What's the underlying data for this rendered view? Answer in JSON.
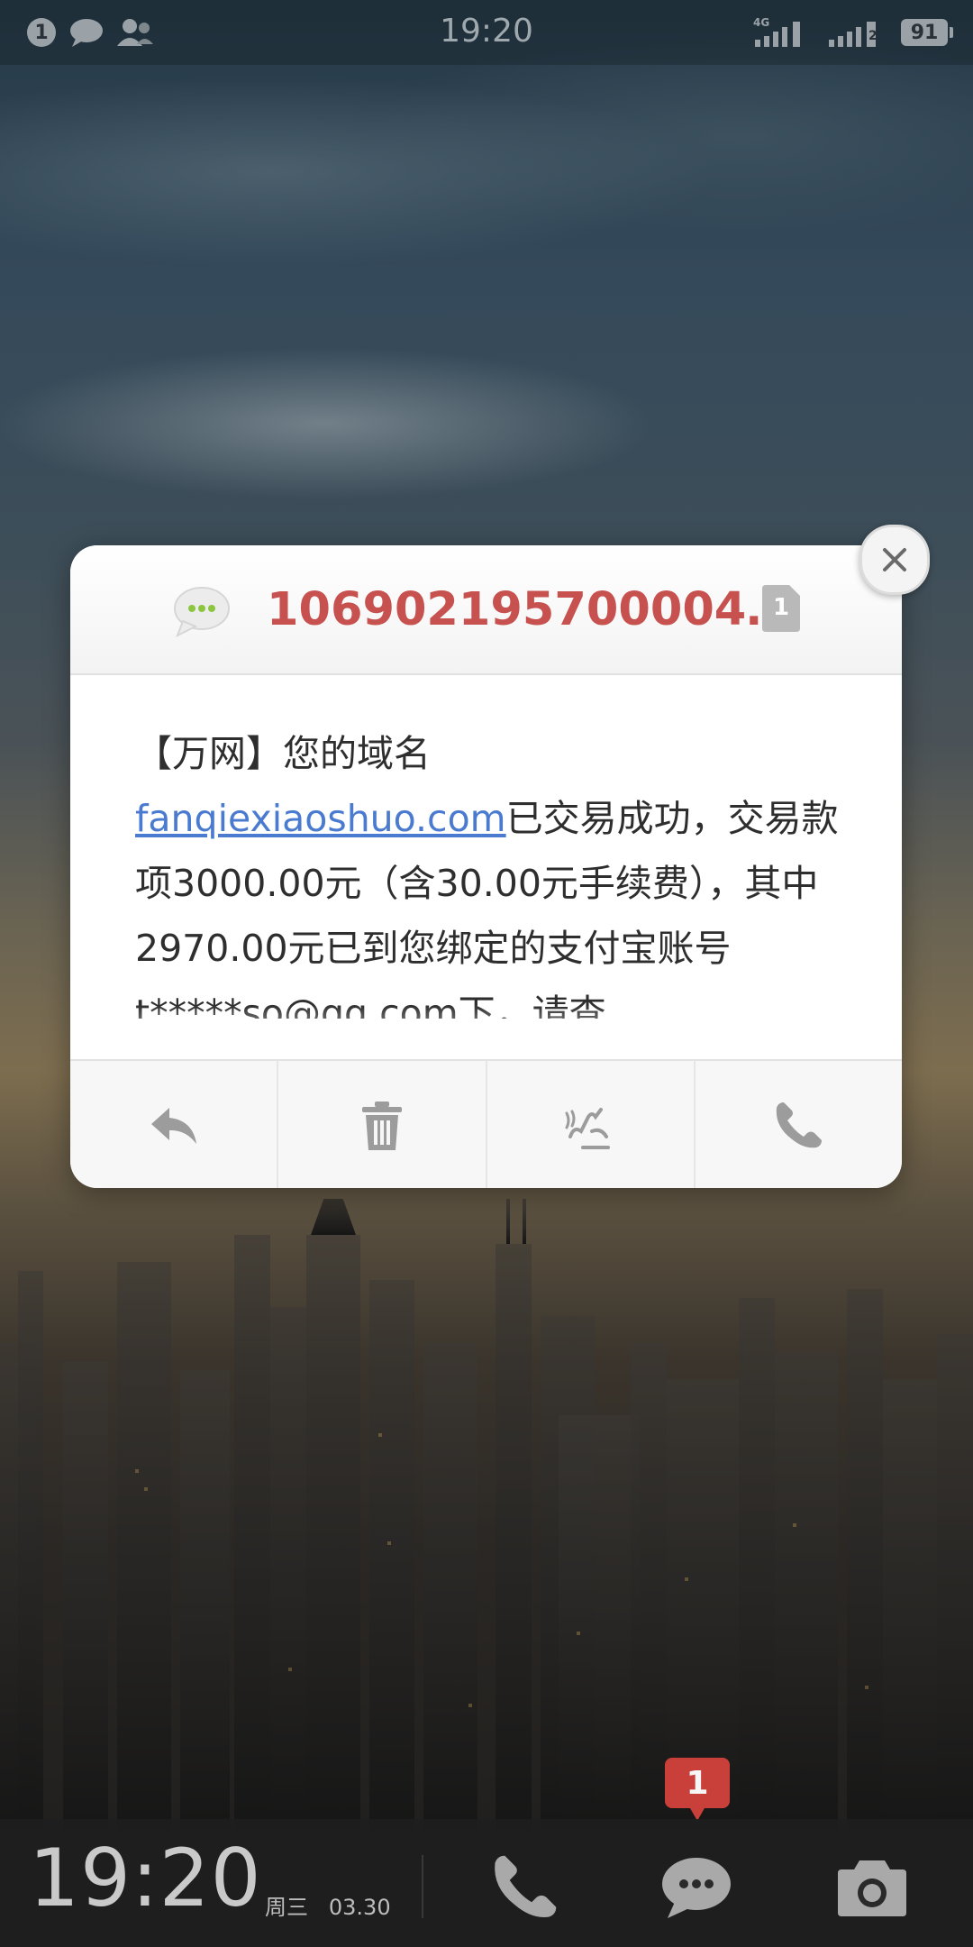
{
  "status_bar": {
    "notification_count": "1",
    "time": "19:20",
    "network_label": "4G",
    "sim2_label": "2",
    "battery": "91"
  },
  "dialog": {
    "sender": "1069021957000040...",
    "body_prefix": "【万网】您的域名",
    "body_link": "fanqiexiaoshuo.com",
    "body_rest": "已交易成功，交易款项3000.00元（含30.00元手续费），其中2970.00元已到您绑定的支付宝账号t*****so@qq.com下，请查",
    "sim_label": "1",
    "accent_color": "#c7514f"
  },
  "lock_bar": {
    "time": "19:20",
    "weekday": "周三",
    "date": "03.30",
    "unread_badge": "1"
  }
}
